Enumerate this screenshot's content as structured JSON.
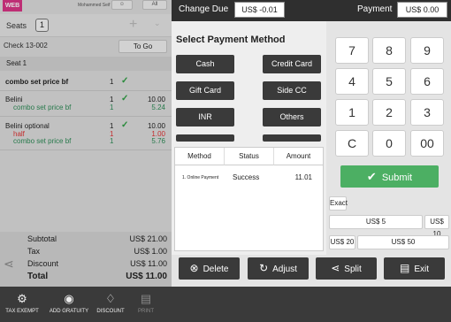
{
  "app": {
    "logo_text": "WEB",
    "user_name": "Mohammed Seif",
    "all_label": "All"
  },
  "order": {
    "seats_label": "Seats",
    "seats_count": "1",
    "check_label": "Check  13-002",
    "to_go_label": "To Go",
    "seat_header": "Seat 1",
    "items": [
      {
        "name": "combo set price bf",
        "qty": "1",
        "price": "",
        "sub": []
      },
      {
        "name": "Belini",
        "qty": "1",
        "price": "10.00",
        "sub": [
          {
            "name": "combo set price bf",
            "qty": "1",
            "price": "5.24",
            "color": "green"
          }
        ]
      },
      {
        "name": "Belini optional",
        "qty": "1",
        "price": "10.00",
        "sub": [
          {
            "name": "half",
            "qty": "1",
            "price": "1.00",
            "color": "red"
          },
          {
            "name": "combo set price bf",
            "qty": "1",
            "price": "5.76",
            "color": "green"
          }
        ]
      }
    ],
    "totals": [
      {
        "label": "Subtotal",
        "value": "US$ 21.00"
      },
      {
        "label": "Tax",
        "value": "US$ 1.00"
      },
      {
        "label": "Discount",
        "value": "US$ 11.00"
      },
      {
        "label": "Total",
        "value": "US$ 11.00"
      }
    ]
  },
  "footer_buttons": [
    {
      "label": "TAX EXEMPT",
      "icon": "percent-icon"
    },
    {
      "label": "ADD GRATUITY",
      "icon": "money-bag-icon"
    },
    {
      "label": "DISCOUNT",
      "icon": "tag-icon"
    },
    {
      "label": "PRINT",
      "icon": "printer-icon"
    }
  ],
  "payment": {
    "change_due_label": "Change Due",
    "change_due_value": "US$ -0.01",
    "payment_label": "Payment",
    "payment_value": "US$ 0.00",
    "select_title": "Select Payment Method",
    "methods": [
      "Cash",
      "Credit Card",
      "Gift Card",
      "Side CC",
      "INR",
      "Others"
    ],
    "table_headers": [
      "Method",
      "Status",
      "Amount"
    ],
    "rows": [
      {
        "method": "1. Online Payment",
        "status": "Success",
        "amount": "11.01"
      }
    ]
  },
  "keypad": {
    "keys": [
      "7",
      "8",
      "9",
      "4",
      "5",
      "6",
      "1",
      "2",
      "3",
      "C",
      "0",
      "00"
    ],
    "submit_label": "Submit",
    "exact_label": "Exact",
    "quick_amounts": [
      "US$ 5",
      "US$ 10",
      "US$ 20",
      "US$ 50"
    ]
  },
  "actions": [
    {
      "label": "Delete",
      "icon": "delete-icon"
    },
    {
      "label": "Adjust",
      "icon": "adjust-icon"
    },
    {
      "label": "Split",
      "icon": "split-icon"
    },
    {
      "label": "Exit",
      "icon": "exit-icon"
    }
  ],
  "colors": {
    "submit_green": "#4caf63",
    "dark": "#3a3a3a",
    "accent_pink": "#d93586"
  }
}
